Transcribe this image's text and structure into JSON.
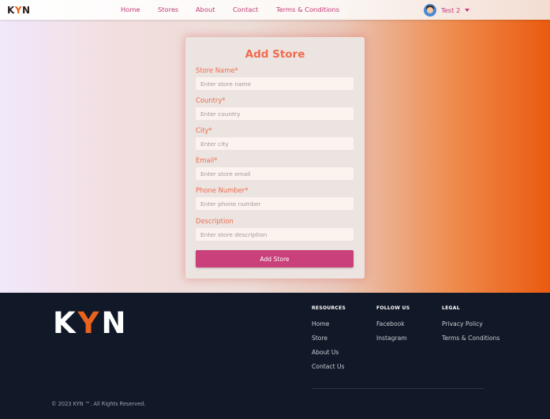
{
  "nav": {
    "logo": {
      "k": "K",
      "y": "Y",
      "n": "N"
    },
    "links": [
      "Home",
      "Stores",
      "About",
      "Contact",
      "Terms & Conditions"
    ],
    "user": {
      "name": "Test 2"
    }
  },
  "form": {
    "title": "Add Store",
    "fields": [
      {
        "label": "Store Name*",
        "placeholder": "Enter store name",
        "value": ""
      },
      {
        "label": "Country*",
        "placeholder": "Enter country",
        "value": ""
      },
      {
        "label": "City*",
        "placeholder": "Enter city",
        "value": ""
      },
      {
        "label": "Email*",
        "placeholder": "Enter store email",
        "value": ""
      },
      {
        "label": "Phone Number*",
        "placeholder": "Enter phone number",
        "value": ""
      },
      {
        "label": "Description",
        "placeholder": "Enter store description",
        "value": ""
      }
    ],
    "submit_label": "Add Store"
  },
  "footer": {
    "logo": {
      "k": "K",
      "y": "Y",
      "n": "N"
    },
    "columns": [
      {
        "heading": "RESOURCES",
        "links": [
          "Home",
          "Store",
          "About Us",
          "Contact Us"
        ]
      },
      {
        "heading": "FOLLOW US",
        "links": [
          "Facebook",
          "Instagram"
        ]
      },
      {
        "heading": "LEGAL",
        "links": [
          "Privacy Policy",
          "Terms & Conditions"
        ]
      }
    ],
    "copyright": "© 2023 KYN ™. All Rights Reserved."
  },
  "colors": {
    "accent": "#c9407a",
    "label": "#ee6c50",
    "brand_orange": "#e8641e",
    "footer_bg": "#111827"
  }
}
